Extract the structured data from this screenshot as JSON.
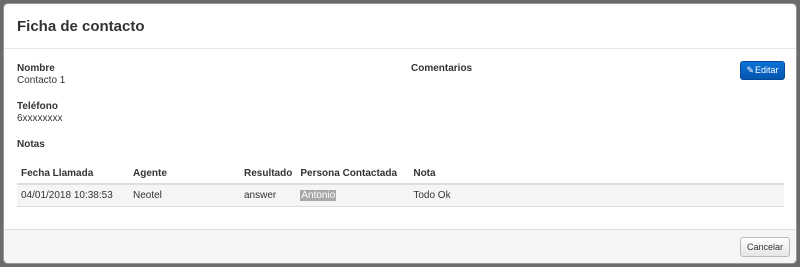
{
  "modal": {
    "title": "Ficha de contacto",
    "edit_label": "Editar",
    "cancel_label": "Cancelar"
  },
  "fields": {
    "nombre_label": "Nombre",
    "nombre_value": "Contacto 1",
    "telefono_label": "Teléfono",
    "telefono_value": "6xxxxxxxx",
    "notas_label": "Notas",
    "comentarios_label": "Comentarios"
  },
  "notes_table": {
    "headers": [
      "Fecha Llamada",
      "Agente",
      "Resultado",
      "Persona Contactada",
      "Nota"
    ],
    "rows": [
      [
        "04/01/2018 10:38:53",
        "Neotel",
        "answer",
        "Antonio",
        "Todo Ok"
      ]
    ]
  },
  "colors": {
    "primary_button": "#0a72d6",
    "overlay": "#6b6b6b",
    "highlight": "#a8a8a8"
  }
}
